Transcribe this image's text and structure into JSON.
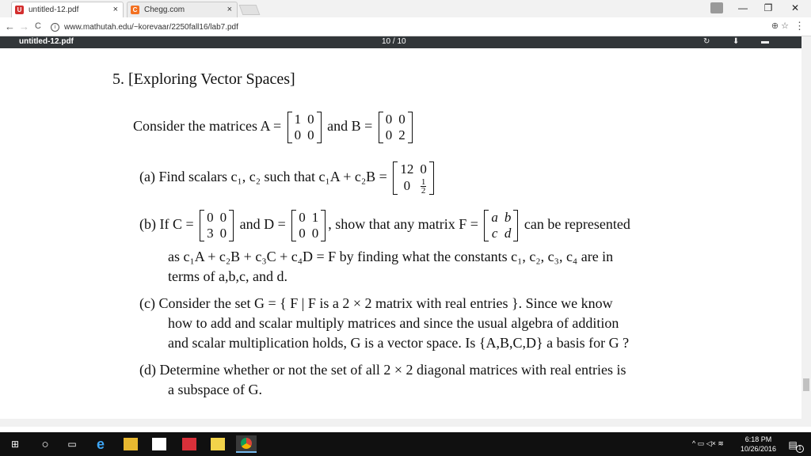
{
  "browser": {
    "tabs": [
      {
        "title": "untitled-12.pdf",
        "favicon": "U",
        "favicon_color": "#d32f2f"
      },
      {
        "title": "Chegg.com",
        "favicon": "C",
        "favicon_color": "#f37021"
      }
    ],
    "close_glyph": "×",
    "window_controls": {
      "minimize": "—",
      "restore": "❐",
      "close": "✕"
    },
    "nav": {
      "back": "←",
      "forward": "→",
      "reload": "C"
    },
    "url": "www.mathutah.edu/~korevaar/2250fall16/lab7.pdf",
    "omnibox_icons": "⊕ ☆",
    "menu": "⋮"
  },
  "pdf_viewer": {
    "file_name": "untitled-12.pdf",
    "page_indicator": "10 / 10",
    "rotate_icon": "↻",
    "download_icon": "⬇",
    "print_icon": "▬"
  },
  "document": {
    "problem_title": "5.  [Exploring Vector Spaces]",
    "intro": "Consider the matrices A =",
    "and_b": "and B =",
    "matrix_A": [
      [
        "1",
        "0"
      ],
      [
        "0",
        "0"
      ]
    ],
    "matrix_B": [
      [
        "0",
        "0"
      ],
      [
        "0",
        "2"
      ]
    ],
    "part_a": "(a)  Find scalars c₁, c₂ such that c₁A + c₂B =",
    "matrix_a_target": {
      "r1c1": "12",
      "r1c2": "0",
      "r2c1": "0",
      "frac_num": "1",
      "frac_den": "2"
    },
    "part_b_lead": "(b)  If C =",
    "and_d": "and D =",
    "show_text": ", show that any matrix F =",
    "can_be": "can be represented",
    "matrix_C": [
      [
        "0",
        "0"
      ],
      [
        "3",
        "0"
      ]
    ],
    "matrix_D": [
      [
        "0",
        "1"
      ],
      [
        "0",
        "0"
      ]
    ],
    "matrix_F": [
      [
        "a",
        "b"
      ],
      [
        "c",
        "d"
      ]
    ],
    "part_b_line2": "as c₁A + c₂B + c₃C + c₄D  =  F by finding what the constants c₁, c₂, c₃, c₄ are in",
    "part_b_line3": "terms of a,b,c, and d.",
    "part_c_line1": "(c)  Consider the set G = { F | F is a 2 × 2 matrix with real entries }. Since we know",
    "part_c_line2": "how to add and scalar multiply matrices and since the usual algebra of addition",
    "part_c_line3": "and scalar multiplication holds, G is a vector space. Is {A,B,C,D} a basis for G ?",
    "part_d_line1": "(d)  Determine whether or not the set of all 2 × 2 diagonal matrices with real entries is",
    "part_d_line2": "a subspace of G."
  },
  "taskbar": {
    "start": "⊞",
    "search": "○",
    "task_view": "▭",
    "edge": "e",
    "time": "6:18 PM",
    "date": "10/26/2016",
    "tray_icons": "^  ▭  ◁×  ≋",
    "notification": "▤",
    "notification_count": "1"
  }
}
